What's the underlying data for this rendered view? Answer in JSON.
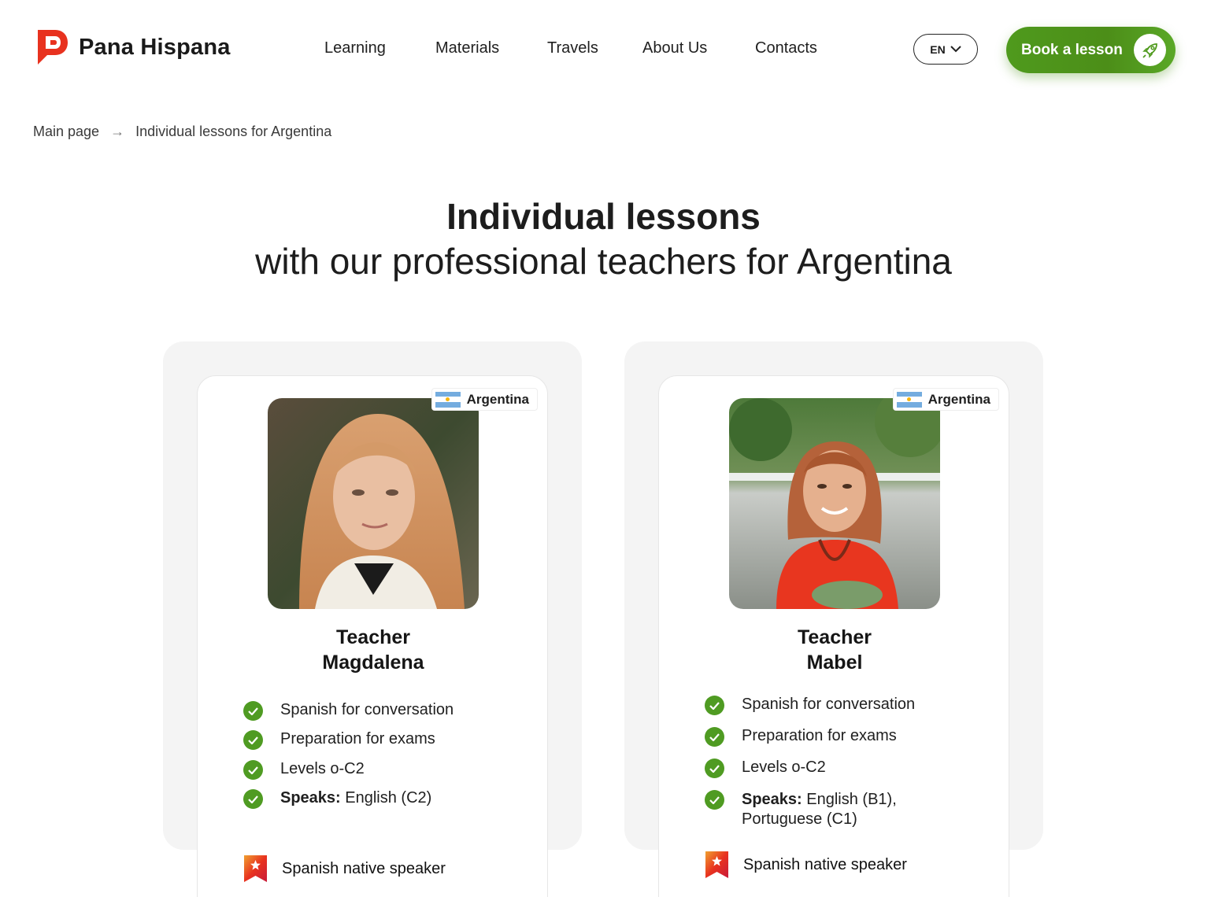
{
  "brand": {
    "name": "Pana Hispana",
    "accent": "#e8321f",
    "green": "#4f9b22"
  },
  "nav": {
    "items": [
      {
        "label": "Learning"
      },
      {
        "label": "Materials"
      },
      {
        "label": "Travels"
      },
      {
        "label": "About Us"
      },
      {
        "label": "Contacts"
      }
    ],
    "language": "EN",
    "book_label": "Book a lesson"
  },
  "breadcrumb": {
    "home": "Main page",
    "arrow": "→",
    "current": "Individual lessons for Argentina"
  },
  "page": {
    "title_bold": "Individual lessons",
    "title_rest": "with our professional teachers for Argentina"
  },
  "teachers": [
    {
      "country": "Argentina",
      "title": "Teacher",
      "name": "Magdalena",
      "features": [
        "Spanish for conversation",
        "Preparation for exams",
        "Levels o-C2"
      ],
      "speaks_label": "Speaks:",
      "speaks_value": " English (C2)",
      "native": "Spanish native speaker"
    },
    {
      "country": "Argentina",
      "title": "Teacher",
      "name": "Mabel",
      "features": [
        "Spanish for conversation",
        "Preparation for exams",
        "Levels o-C2"
      ],
      "speaks_label": "Speaks:",
      "speaks_value": " English (B1),",
      "speaks_value2": "Portuguese (C1)",
      "native": "Spanish native speaker"
    }
  ]
}
